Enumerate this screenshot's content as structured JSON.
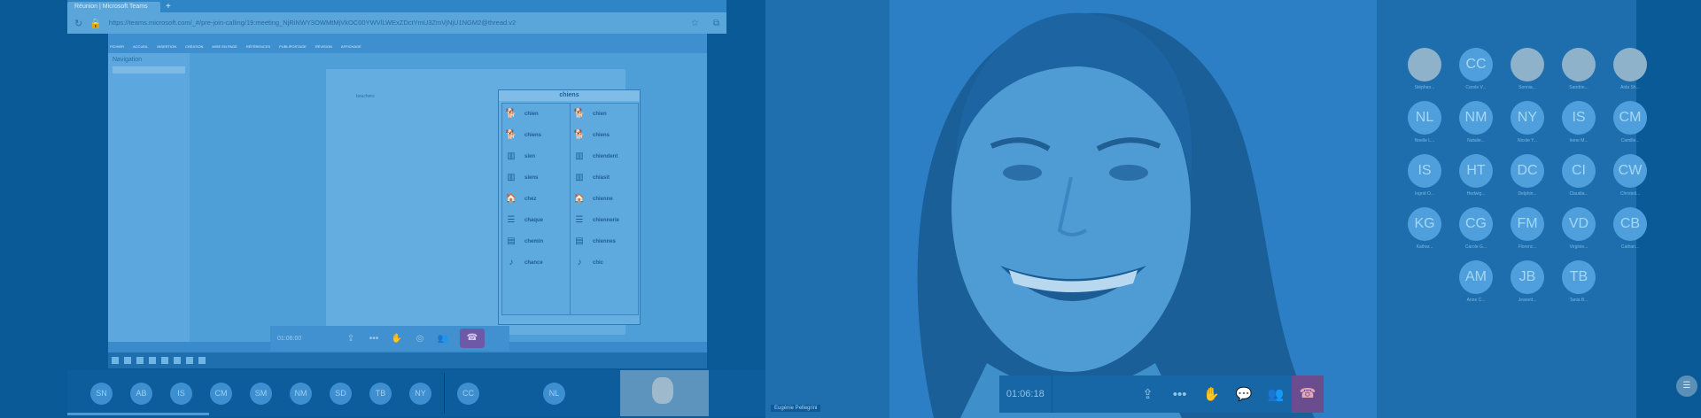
{
  "browser": {
    "tab_title": "Réunion | Microsoft Teams",
    "url": "https://teams.microsoft.com/_#/pre-join-calling/19:meeting_NjRiNWY3OWMtMjVkOC00YWVlLWExZDctYmU3ZmVjNjU1NGM2@thread.v2"
  },
  "word_doc": {
    "navigation_title": "Navigation",
    "page_word": "bouchers",
    "ribbon_tabs": [
      "FICHIER",
      "ACCUEIL",
      "INSERTION",
      "CRÉATION",
      "MISE EN PAGE",
      "RÉFÉRENCES",
      "PUBLIPOSTAGE",
      "RÉVISION",
      "AFFICHAGE"
    ]
  },
  "word_list": {
    "title": "chiens",
    "left_words": [
      "chien",
      "chiens",
      "sien",
      "siens",
      "chez",
      "chaque",
      "chemin",
      "chance"
    ],
    "right_words": [
      "chien",
      "chiens",
      "chiendent",
      "chiasit",
      "chienne",
      "chiennerie",
      "chiennes",
      "chic"
    ]
  },
  "share_controls": {
    "time": "01:06:00"
  },
  "left_roster": [
    "SN",
    "AB",
    "IS",
    "CM",
    "SM",
    "NM",
    "SD",
    "TB",
    "NY",
    "CC",
    "NL"
  ],
  "main_call": {
    "time": "01:06:18",
    "speaker_name": "Eugénie Pellegrini",
    "colors": {
      "hangup": "#6b4c8f",
      "controls_bg": "#1767a6"
    }
  },
  "participants": [
    {
      "initials": "",
      "name": "Stéphan...",
      "photo": true
    },
    {
      "initials": "CC",
      "name": "Carole V..."
    },
    {
      "initials": "",
      "name": "Sonnia...",
      "photo": true
    },
    {
      "initials": "",
      "name": "Sandrin...",
      "photo": true
    },
    {
      "initials": "",
      "name": "Aida Sh...",
      "photo": true
    },
    {
      "initials": "NL",
      "name": "Noelle L..."
    },
    {
      "initials": "NM",
      "name": "Natalie..."
    },
    {
      "initials": "NY",
      "name": "Nicole Y..."
    },
    {
      "initials": "IS",
      "name": "Irene M..."
    },
    {
      "initials": "CM",
      "name": "Camille..."
    },
    {
      "initials": "IS",
      "name": "Ingrid O..."
    },
    {
      "initials": "HT",
      "name": "Hedwig..."
    },
    {
      "initials": "DC",
      "name": "Delphin..."
    },
    {
      "initials": "CI",
      "name": "Claudia..."
    },
    {
      "initials": "CW",
      "name": "Christell..."
    },
    {
      "initials": "KG",
      "name": "Kathar..."
    },
    {
      "initials": "CG",
      "name": "Carole G..."
    },
    {
      "initials": "FM",
      "name": "Florenc..."
    },
    {
      "initials": "VD",
      "name": "Virginie..."
    },
    {
      "initials": "CB",
      "name": "Cathari..."
    },
    {
      "initials": "AM",
      "name": "Anne C..."
    },
    {
      "initials": "JB",
      "name": "Jeanett..."
    },
    {
      "initials": "TB",
      "name": "Tania B..."
    }
  ]
}
